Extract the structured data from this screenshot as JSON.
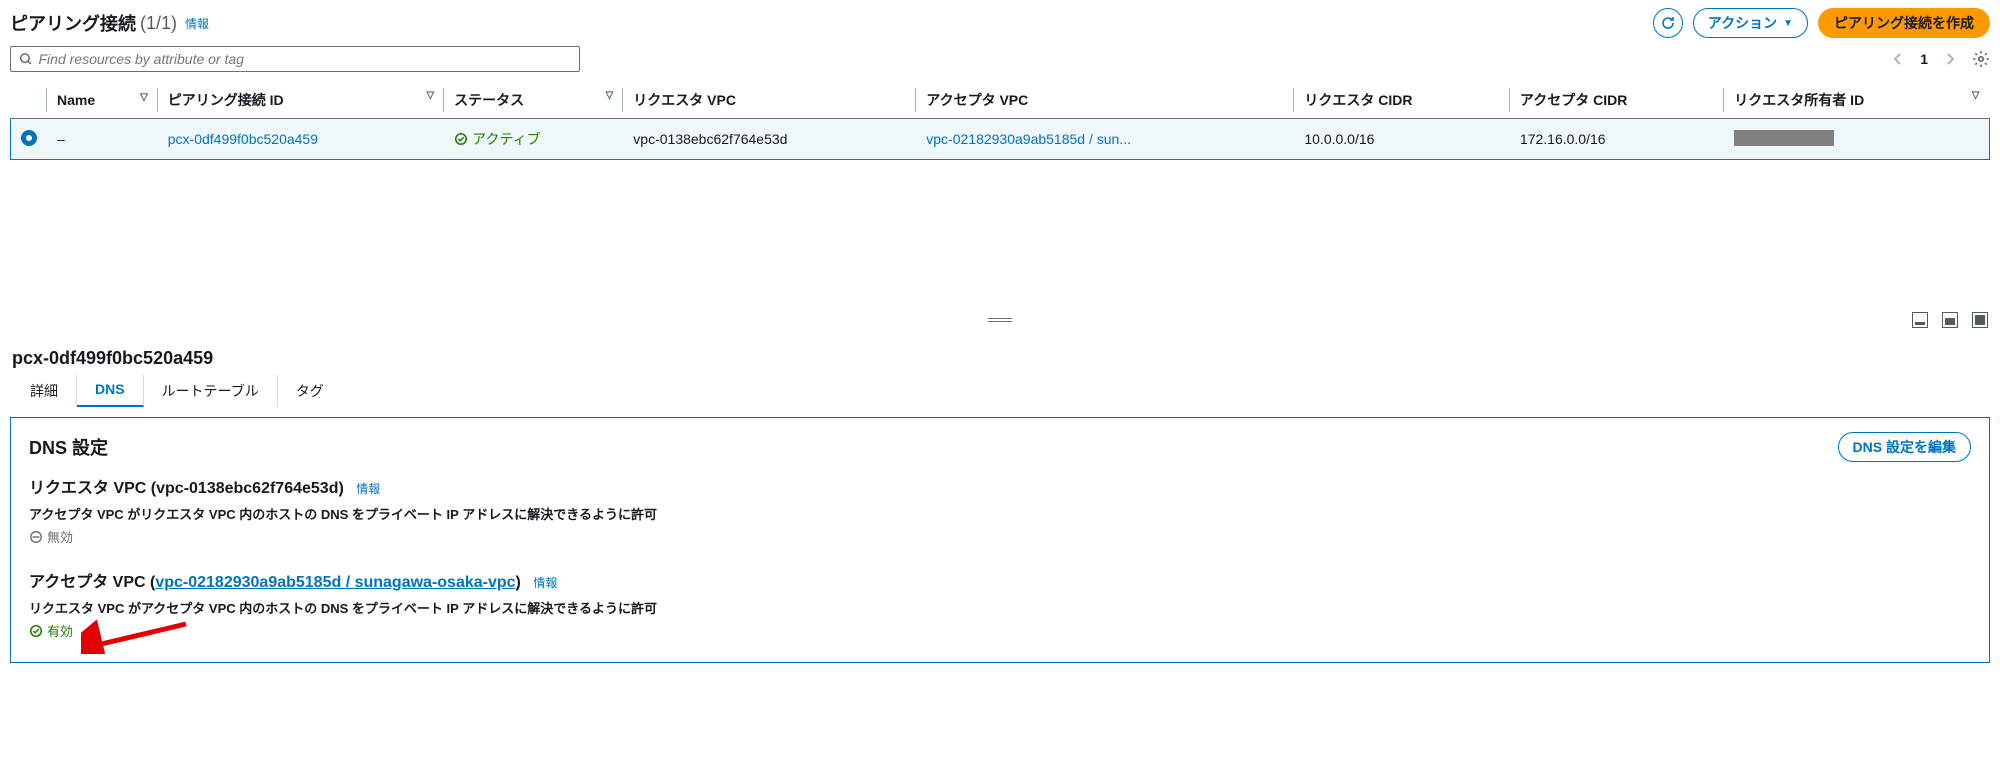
{
  "header": {
    "title": "ピアリング接続",
    "count": "(1/1)",
    "info": "情報",
    "actions": "アクション",
    "create": "ピアリング接続を作成"
  },
  "search": {
    "placeholder": "Find resources by attribute or tag",
    "page": "1"
  },
  "table": {
    "cols": {
      "name": "Name",
      "pcx": "ピアリング接続 ID",
      "status": "ステータス",
      "req_vpc": "リクエスタ VPC",
      "acc_vpc": "アクセプタ VPC",
      "req_cidr": "リクエスタ CIDR",
      "acc_cidr": "アクセプタ CIDR",
      "req_owner": "リクエスタ所有者 ID"
    },
    "row": {
      "name": "–",
      "pcx": "pcx-0df499f0bc520a459",
      "status": "アクティブ",
      "req_vpc": "vpc-0138ebc62f764e53d",
      "acc_vpc": "vpc-02182930a9ab5185d / sun...",
      "req_cidr": "10.0.0.0/16",
      "acc_cidr": "172.16.0.0/16"
    }
  },
  "detail": {
    "title": "pcx-0df499f0bc520a459",
    "tabs": {
      "t1": "詳細",
      "t2": "DNS",
      "t3": "ルートテーブル",
      "t4": "タグ"
    },
    "panel_title": "DNS 設定",
    "edit_btn": "DNS 設定を編集",
    "req": {
      "label": "リクエスタ VPC (vpc-0138ebc62f764e53d)",
      "info": "情報",
      "desc": "アクセプタ VPC がリクエスタ VPC 内のホストの DNS をプライベート IP アドレスに解決できるように許可",
      "status": "無効"
    },
    "acc": {
      "prefix": "アクセプタ VPC (",
      "link": "vpc-02182930a9ab5185d / sunagawa-osaka-vpc",
      "suffix": ")",
      "info": "情報",
      "desc": "リクエスタ VPC がアクセプタ VPC 内のホストの DNS をプライベート IP アドレスに解決できるように許可",
      "status": "有効"
    }
  }
}
